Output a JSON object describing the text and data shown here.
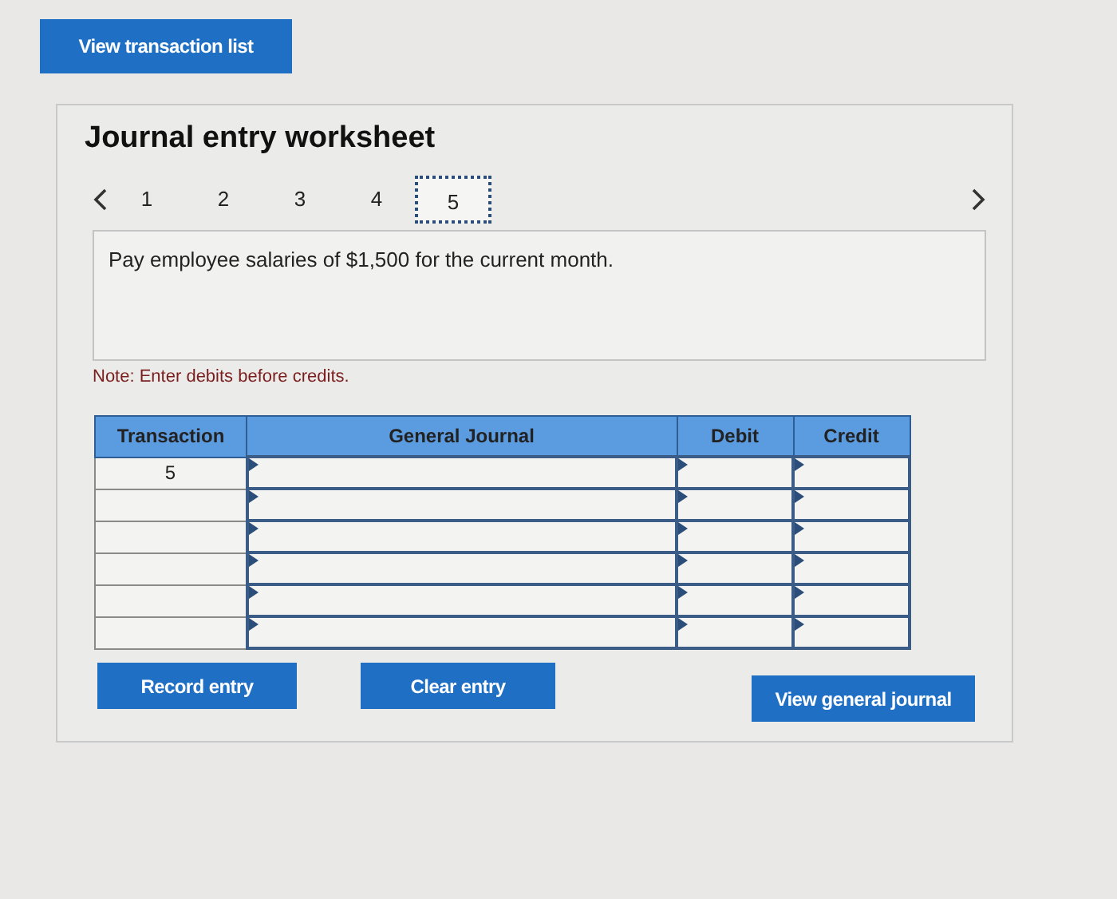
{
  "top_button": "View transaction list",
  "worksheet": {
    "title": "Journal entry worksheet",
    "steps": [
      {
        "label": "1",
        "selected": false
      },
      {
        "label": "2",
        "selected": false
      },
      {
        "label": "3",
        "selected": false
      },
      {
        "label": "4",
        "selected": false
      },
      {
        "label": "5",
        "selected": true
      }
    ],
    "prompt": "Pay employee salaries of $1,500 for the current month.",
    "note": "Note: Enter debits before credits.",
    "table": {
      "columns": [
        "Transaction",
        "General Journal",
        "Debit",
        "Credit"
      ],
      "rows": [
        {
          "transaction": "5"
        },
        {},
        {},
        {},
        {},
        {}
      ]
    },
    "buttons": [
      "Record entry",
      "Clear entry",
      "View general journal"
    ]
  }
}
